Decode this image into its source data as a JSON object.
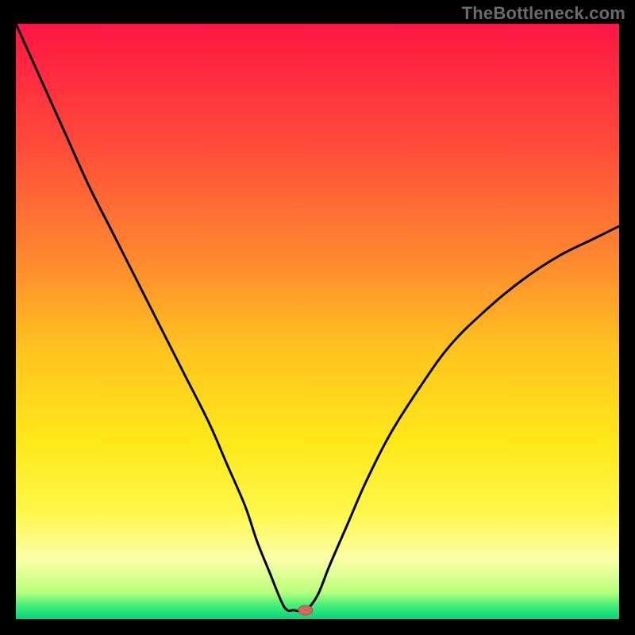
{
  "watermark": "TheBottleneck.com",
  "colors": {
    "frame": "#000000",
    "watermark": "#6b6b6b",
    "curve": "#000000",
    "marker_fill": "#cf6a5f",
    "marker_stroke": "#a54a40",
    "gradient_stops": [
      {
        "offset": 0.0,
        "color": "#ff1544"
      },
      {
        "offset": 0.2,
        "color": "#ff4a3a"
      },
      {
        "offset": 0.4,
        "color": "#ff8a2f"
      },
      {
        "offset": 0.55,
        "color": "#ffc41f"
      },
      {
        "offset": 0.7,
        "color": "#ffe81a"
      },
      {
        "offset": 0.82,
        "color": "#fff74a"
      },
      {
        "offset": 0.9,
        "color": "#fbffa8"
      },
      {
        "offset": 0.955,
        "color": "#b7ff7c"
      },
      {
        "offset": 0.975,
        "color": "#4cf07a"
      },
      {
        "offset": 1.0,
        "color": "#00d481"
      }
    ]
  },
  "chart_data": {
    "type": "line",
    "title": "",
    "xlabel": "",
    "ylabel": "",
    "xlim": [
      0,
      100
    ],
    "ylim": [
      0,
      100
    ],
    "series": [
      {
        "name": "bottleneck-curve",
        "x": [
          0,
          4,
          8,
          12,
          16,
          20,
          24,
          28,
          32,
          35,
          38,
          40,
          42,
          44,
          45,
          46,
          48,
          50,
          52,
          55,
          58,
          62,
          67,
          72,
          78,
          84,
          90,
          96,
          100
        ],
        "y": [
          100,
          91,
          82,
          73,
          65,
          57,
          49,
          41,
          33,
          26,
          19,
          13,
          8,
          3,
          1.5,
          1.5,
          1.5,
          4,
          9,
          16,
          23,
          31,
          39,
          46,
          52,
          57,
          61,
          64,
          66
        ]
      }
    ],
    "flat_segment": {
      "x0": 44,
      "x1": 48,
      "y": 1.5
    },
    "marker": {
      "x": 48,
      "y": 1.5
    }
  }
}
